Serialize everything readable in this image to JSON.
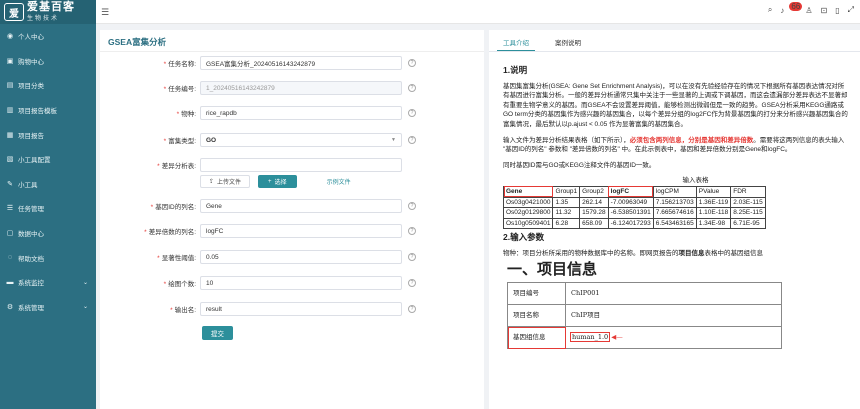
{
  "brand": {
    "logo_glyph": "爱",
    "name": "爱基百客",
    "sub": "生物技术"
  },
  "sidebar": {
    "items": [
      {
        "label": "个人中心",
        "icon": "user-icon"
      },
      {
        "label": "购物中心",
        "icon": "cart-icon"
      },
      {
        "label": "项目分类",
        "icon": "folder-icon"
      },
      {
        "label": "项目报告模板",
        "icon": "template-icon"
      },
      {
        "label": "项目报告",
        "icon": "report-icon"
      },
      {
        "label": "小工具配置",
        "icon": "config-icon"
      },
      {
        "label": "小工具",
        "icon": "tool-icon"
      },
      {
        "label": "任务管理",
        "icon": "task-icon"
      },
      {
        "label": "数据中心",
        "icon": "database-icon"
      },
      {
        "label": "帮助文档",
        "icon": "help-icon"
      },
      {
        "label": "系统监控",
        "icon": "monitor-icon"
      },
      {
        "label": "系统管理",
        "icon": "settings-icon"
      }
    ]
  },
  "topbar": {
    "notification_count": "66"
  },
  "form": {
    "title": "GSEA富集分析",
    "task_name_label": "任务名称:",
    "task_name_value": "GSEA富集分析_20240516143242879",
    "task_id_label": "任务编号:",
    "task_id_value": "1_20240516143242879",
    "species_label": "物种:",
    "species_value": "rice_rapdb",
    "enrich_type_label": "富集类型:",
    "enrich_type_value": "GO",
    "file_label": "差异分析表:",
    "upload_button": "上传文件",
    "select_button": "选择",
    "example_link": "示例文件",
    "gene_col_label": "基因ID的列名:",
    "gene_col_value": "Gene",
    "fc_col_label": "差异倍数的列名:",
    "fc_col_value": "logFC",
    "pvalue_label": "显著性阈值:",
    "pvalue_value": "0.05",
    "plot_count_label": "绘图个数:",
    "plot_count_value": "10",
    "output_label": "输出名:",
    "output_value": "result",
    "submit_button": "提交"
  },
  "right": {
    "tabs": [
      "工具介绍",
      "案例说明"
    ],
    "sec1_title": "1.说明",
    "sec1_para1": "基因集富集分析(GSEA: Gene Set Enrichment Analysis)，可以在没有先验经验存在的情况下根据所有基因表达情况对所有基因进行富集分析。一般的差异分析通常只集中关注于一些显著的上调或下调基因，而这会遗漏部分差异表达不显著却有重要生物学意义的基因。而GSEA不会设置差异阈值，能够检测出微弱但是一致的趋势。GSEA分析采用KEGG通路或GO term分类的基因集作为感兴趣的基因集合，以每个差异分组的log2FC作为背景基因集的打分来分析感兴趣基因集合的富集情况，最后默认以p.ajust < 0.05 作为显著富集的基因集合。",
    "sec1_para2_a": "输入文件为差异分析结果表格（如下所示），",
    "sec1_para2_red": "必须包含两列信息，分别是基因和差异倍数",
    "sec1_para2_b": "。需要将这两列信息的表头输入 \"基因ID的列名\" 参数和 \"差异倍数的列名\" 中。在此示例表中，基因和差异倍数分别是Gene和logFC。",
    "sec1_para3": "同时基因ID需与GO或KEGG注释文件的基因ID一致。",
    "table_title": "输入表格",
    "table_header": [
      "Gene",
      "Group1",
      "Group2",
      "logFC",
      "logCPM",
      "PValue",
      "FDR"
    ],
    "table_rows": [
      [
        "Os03g0421000",
        "1.35",
        "262.14",
        "-7.00963049",
        "7.156213703",
        "1.36E-119",
        "2.03E-115"
      ],
      [
        "Os02g0129800",
        "11.32",
        "1579.28",
        "-6.538501391",
        "7.665674616",
        "1.10E-118",
        "8.25E-115"
      ],
      [
        "Os10g0509401",
        "6.28",
        "658.09",
        "-6.124017293",
        "6.543463165",
        "1.34E-98",
        "6.71E-95"
      ]
    ],
    "sec2_title": "2.输入参数",
    "sec2_text_a": "物种：项目分析所采用的物种数据库中的名称。即网页报告的",
    "sec2_text_bold": "项目信息",
    "sec2_text_b": "表格中的基因组信息",
    "info_heading": "一、项目信息",
    "info_rows": [
      [
        "项目编号",
        "ChIP001"
      ],
      [
        "项目名称",
        "ChIP项目"
      ],
      [
        "基因组信息",
        "human_1.0"
      ]
    ]
  }
}
